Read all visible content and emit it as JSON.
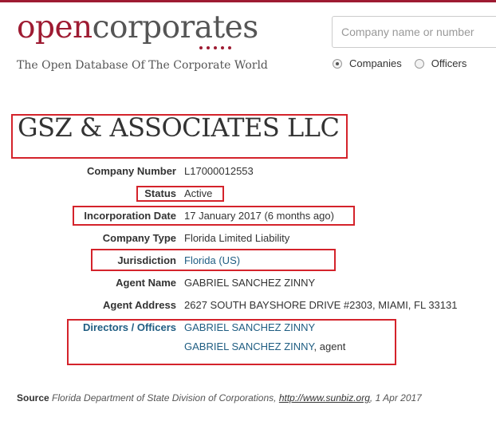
{
  "brand": {
    "logo_open": "open",
    "logo_corporates": "corporates",
    "tagline": "The Open Database Of The Corporate World",
    "accent_color": "#9e1b32"
  },
  "search": {
    "placeholder": "Company name or number",
    "options": [
      {
        "label": "Companies",
        "checked": true
      },
      {
        "label": "Officers",
        "checked": false
      }
    ]
  },
  "company": {
    "name": "GSZ & ASSOCIATES LLC",
    "company_number_label": "Company Number",
    "company_number": "L17000012553",
    "status_label": "Status",
    "status": "Active",
    "incorporation_date_label": "Incorporation Date",
    "incorporation_date": "17 January 2017 (6 months ago)",
    "company_type_label": "Company Type",
    "company_type": "Florida Limited Liability",
    "jurisdiction_label": "Jurisdiction",
    "jurisdiction": "Florida (US)",
    "agent_name_label": "Agent Name",
    "agent_name": "GABRIEL SANCHEZ ZINNY",
    "agent_address_label": "Agent Address",
    "agent_address": "2627 SOUTH BAYSHORE DRIVE #2303, MIAMI, FL 33131",
    "directors_label": "Directors / Officers",
    "officers": [
      {
        "name": "GABRIEL SANCHEZ ZINNY",
        "role": ""
      },
      {
        "name": "GABRIEL SANCHEZ ZINNY",
        "role": ", agent"
      }
    ]
  },
  "source": {
    "label": "Source",
    "text": "Florida Department of State Division of Corporations,",
    "link": "http://www.sunbiz.org",
    "date": ", 1 Apr 2017"
  }
}
